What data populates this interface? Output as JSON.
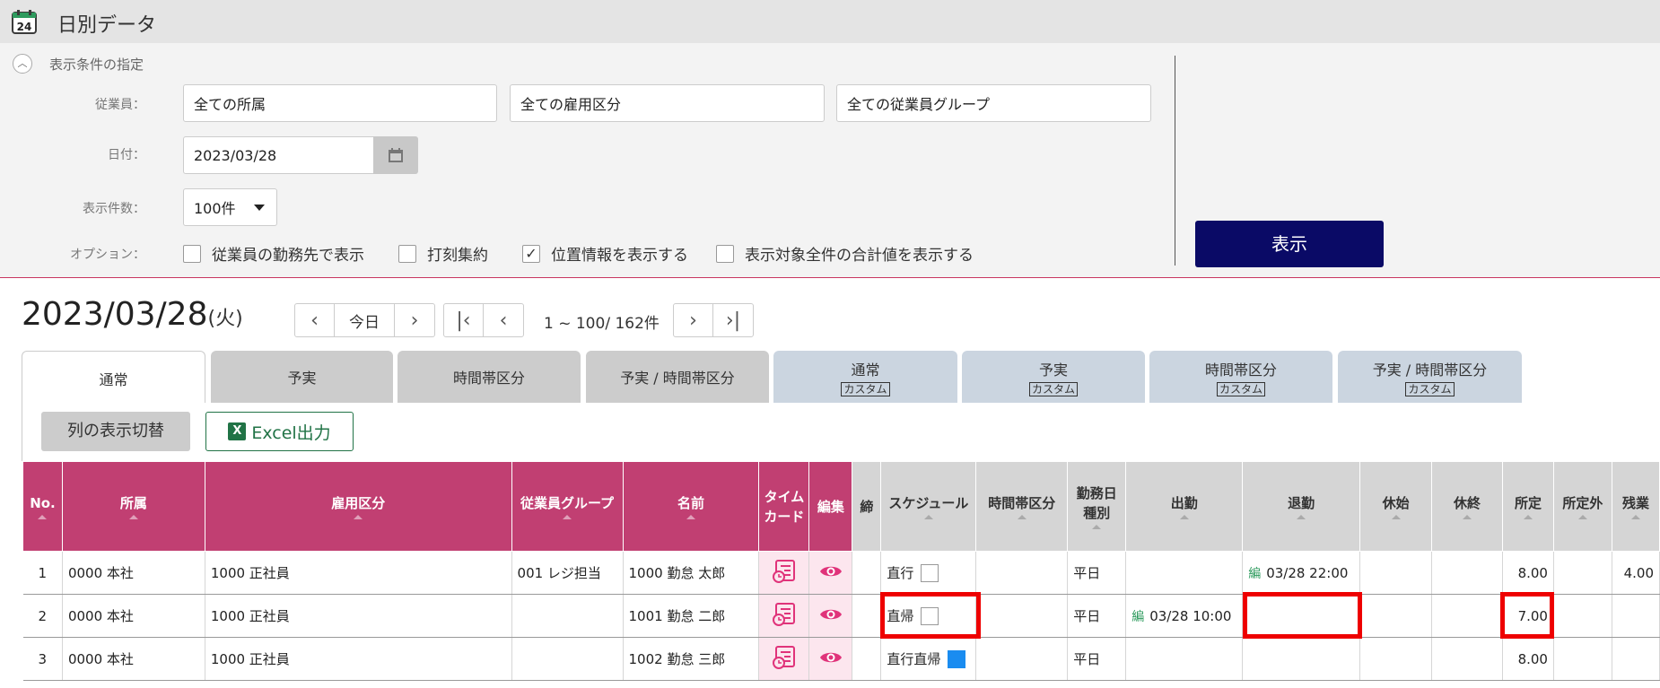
{
  "app": {
    "title": "日別データ"
  },
  "filter": {
    "section_title": "表示条件の指定",
    "employee_label": "従業員：",
    "affiliation": "全ての所属",
    "employment_type": "全ての雇用区分",
    "employee_group": "全ての従業員グループ",
    "date_label": "日付：",
    "date_value": "2023/03/28",
    "count_label": "表示件数：",
    "count_value": "100件",
    "options_label": "オプション：",
    "options": [
      {
        "label": "従業員の勤務先で表示",
        "checked": false
      },
      {
        "label": "打刻集約",
        "checked": false
      },
      {
        "label": "位置情報を表示する",
        "checked": true
      },
      {
        "label": "表示対象全件の合計値を表示する",
        "checked": false
      }
    ],
    "show_button": "表示"
  },
  "header": {
    "date": "2023/03/28",
    "weekday": "(火)",
    "today_label": "今日",
    "page_info": "1 ~ 100/ 162件"
  },
  "tabs": [
    {
      "label": "通常",
      "custom": ""
    },
    {
      "label": "予実",
      "custom": ""
    },
    {
      "label": "時間帯区分",
      "custom": ""
    },
    {
      "label": "予実 / 時間帯区分",
      "custom": ""
    },
    {
      "label": "通常",
      "custom": "カスタム"
    },
    {
      "label": "予実",
      "custom": "カスタム"
    },
    {
      "label": "時間帯区分",
      "custom": "カスタム"
    },
    {
      "label": "予実 / 時間帯区分",
      "custom": "カスタム"
    }
  ],
  "toolbar": {
    "columns_button": "列の表示切替",
    "excel_button": "Excel出力",
    "excel_icon": "excel-icon"
  },
  "table": {
    "headers": [
      "No.",
      "所属",
      "雇用区分",
      "従業員グループ",
      "名前",
      "タイム\nカード",
      "編集",
      "締",
      "スケジュール",
      "時間帯区分",
      "勤務日\n種別",
      "出勤",
      "退勤",
      "休始",
      "休終",
      "所定",
      "所定外",
      "残業"
    ],
    "edit_mark": "編",
    "rows": [
      {
        "no": "1",
        "affiliation": "0000 本社",
        "employment": "1000 正社員",
        "group": "001 レジ担当",
        "name": "1000 勤怠 太郎",
        "schedule": "直行",
        "schedule_box": "empty",
        "day_type": "平日",
        "clock_in": "",
        "clock_out": "03/28 22:00",
        "prescribed": "8.00",
        "overtime": "4.00"
      },
      {
        "no": "2",
        "affiliation": "0000 本社",
        "employment": "1000 正社員",
        "group": "",
        "name": "1001 勤怠 二郎",
        "schedule": "直帰",
        "schedule_box": "empty",
        "day_type": "平日",
        "clock_in": "03/28 10:00",
        "clock_out": "",
        "prescribed": "7.00",
        "overtime": ""
      },
      {
        "no": "3",
        "affiliation": "0000 本社",
        "employment": "1000 正社員",
        "group": "",
        "name": "1002 勤怠 三郎",
        "schedule": "直行直帰",
        "schedule_box": "filled",
        "day_type": "平日",
        "clock_in": "",
        "clock_out": "",
        "prescribed": "8.00",
        "overtime": ""
      }
    ]
  },
  "colors": {
    "accent_pink": "#c13f72",
    "primary_navy": "#0a0a66",
    "excel_green": "#217346",
    "highlight_red": "#e00000"
  }
}
